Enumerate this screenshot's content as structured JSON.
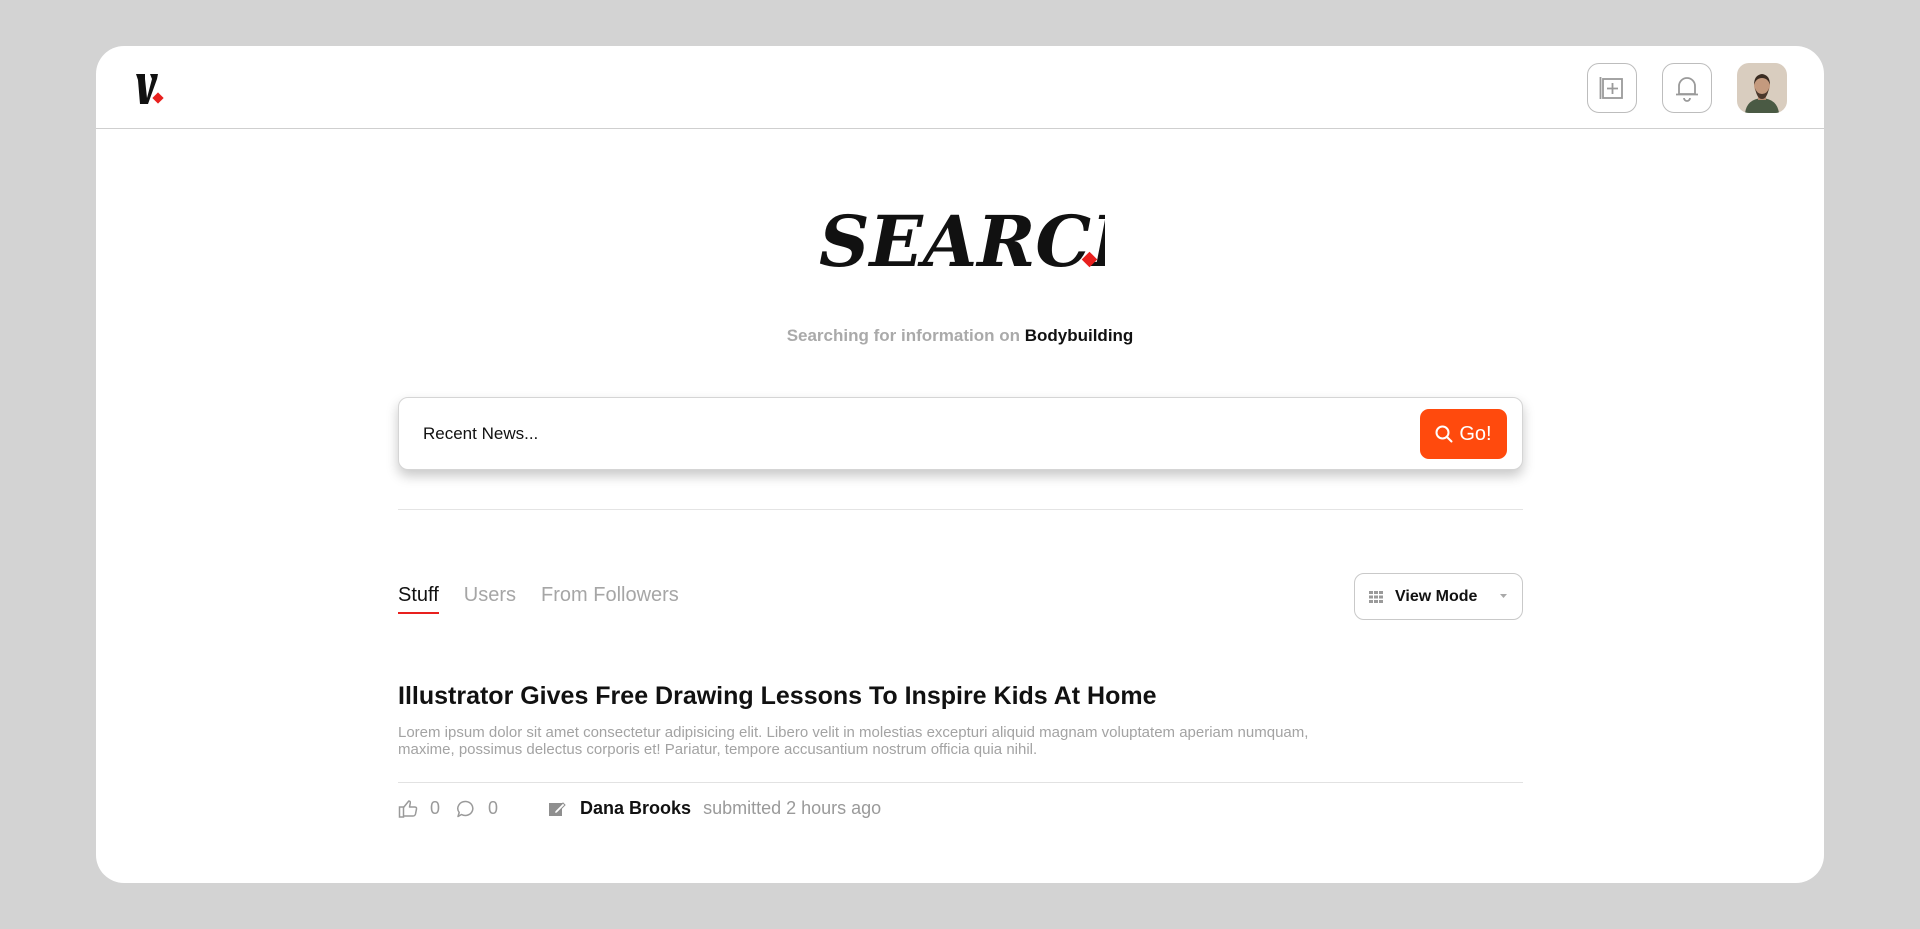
{
  "header": {
    "logo_text": "V.",
    "add_icon": "add-post-icon",
    "bell_icon": "bell-icon",
    "avatar_icon": "user-avatar"
  },
  "hero": {
    "title": "SEARCH.",
    "subtitle_prefix": "Searching for information on",
    "subtitle_topic": "Bodybuilding"
  },
  "search": {
    "placeholder": "Recent News...",
    "value": "",
    "button_label": "Go!",
    "button_icon": "search-icon"
  },
  "tabs": [
    {
      "label": "Stuff",
      "active": true
    },
    {
      "label": "Users",
      "active": false
    },
    {
      "label": "From Followers",
      "active": false
    }
  ],
  "view_mode": {
    "label": "View Mode",
    "icon": "grid-icon"
  },
  "article": {
    "title": "Illustrator Gives Free Drawing Lessons To Inspire Kids At Home",
    "excerpt": "Lorem ipsum dolor sit amet consectetur adipisicing elit. Libero velit in molestias excepturi aliquid magnam voluptatem aperiam numquam, maxime, possimus delectus corporis et! Pariatur, tempore accusantium nostrum officia quia nihil.",
    "likes": "0",
    "comments": "0",
    "author": "Dana Brooks",
    "submitted": "submitted 2 hours ago"
  },
  "colors": {
    "accent": "#ff4a0d",
    "accent_red": "#e8201e",
    "background": "#d3d3d3",
    "muted_text": "#a6a6a6"
  }
}
